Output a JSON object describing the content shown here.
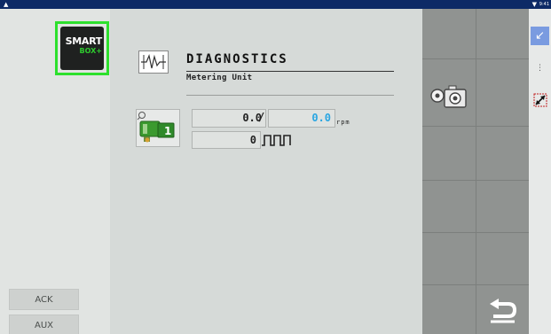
{
  "status_bar": {
    "time": "9:41",
    "home_icon": "home-icon",
    "wifi_icon": "wifi-icon"
  },
  "logo": {
    "line1": "SMART",
    "line2": "BOX+"
  },
  "softkeys": {
    "ack": "ACK",
    "aux": "AUX"
  },
  "header": {
    "title": "DIAGNOSTICS",
    "subtitle": "Metering Unit",
    "icon": "waveform-icon"
  },
  "unit_button": {
    "number": "1",
    "icon": "metering-unit-icon"
  },
  "readouts": {
    "actual_speed": "0.0",
    "separator": "/",
    "target_speed": "0.0",
    "speed_unit": "rpm",
    "pulse_count": "0",
    "pulse_icon": "pulse-signal-icon"
  },
  "side_grid": {
    "camera_icon": "camera-sensor-icon",
    "back_icon": "return-arrow-icon"
  },
  "right_toolbar": {
    "minimize_icon": "minimize-arrow-icon",
    "menu_icon": "more-vert-icon",
    "resize_icon": "resize-icon"
  },
  "colors": {
    "accent_green": "#2de02d",
    "value_blue": "#2aa6e2",
    "status_bar": "#0d2a66"
  }
}
